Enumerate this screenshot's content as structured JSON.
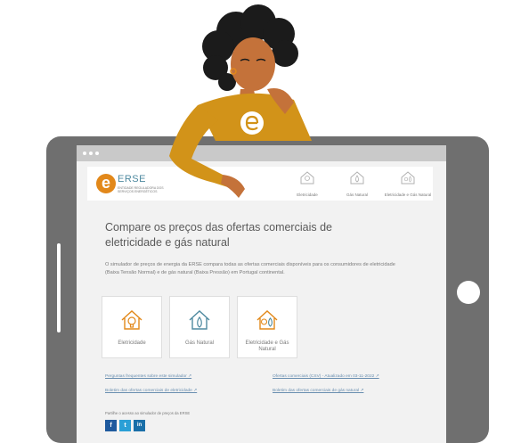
{
  "site": {
    "logo_text": "ERSE",
    "logo_subtitle": "ENTIDADE REGULADORA DOS SERVIÇOS ENERGÉTICOS",
    "nav": [
      {
        "label": "Eletricidade",
        "icon": "bulb-house-icon"
      },
      {
        "label": "Gás Natural",
        "icon": "flame-house-icon"
      },
      {
        "label": "Eletricidade e Gás Natural",
        "icon": "bulb-flame-house-icon"
      }
    ]
  },
  "main": {
    "title": "Compare os preços das ofertas comerciais de eletricidade e gás natural",
    "intro": "O simulador de preços de energia da ERSE compara todas as ofertas comerciais disponíveis para os consumidores de eletricidade (Baixa Tensão Normal) e de gás natural (Baixa Pressão) em Portugal continental.",
    "cards": [
      {
        "label": "Eletricidade",
        "icon": "bulb-house-icon"
      },
      {
        "label": "Gás Natural",
        "icon": "flame-house-icon"
      },
      {
        "label": "Eletricidade e Gás Natural",
        "icon": "bulb-flame-house-icon"
      }
    ],
    "links": {
      "faq": "Perguntas frequentes sobre este simulador ↗",
      "offers_csv": "Ofertas comerciais (CSV) - Atualizado em 03-11-2022 ↗",
      "bulletin_electricity": "Boletim das ofertas comerciais de eletricidade ↗",
      "bulletin_gas": "Boletim das ofertas comerciais de gás natural ↗"
    },
    "share": {
      "label": "Partilhe o acesso ao simulador de preços da ERSE",
      "buttons": [
        "f",
        "t",
        "in"
      ]
    }
  },
  "colors": {
    "orange": "#e2881a",
    "blue": "#4f8aa0",
    "facebook": "#1f5a9e",
    "twitter": "#2a9fd6",
    "linkedin": "#1a6fa8",
    "shirt": "#d29319"
  }
}
